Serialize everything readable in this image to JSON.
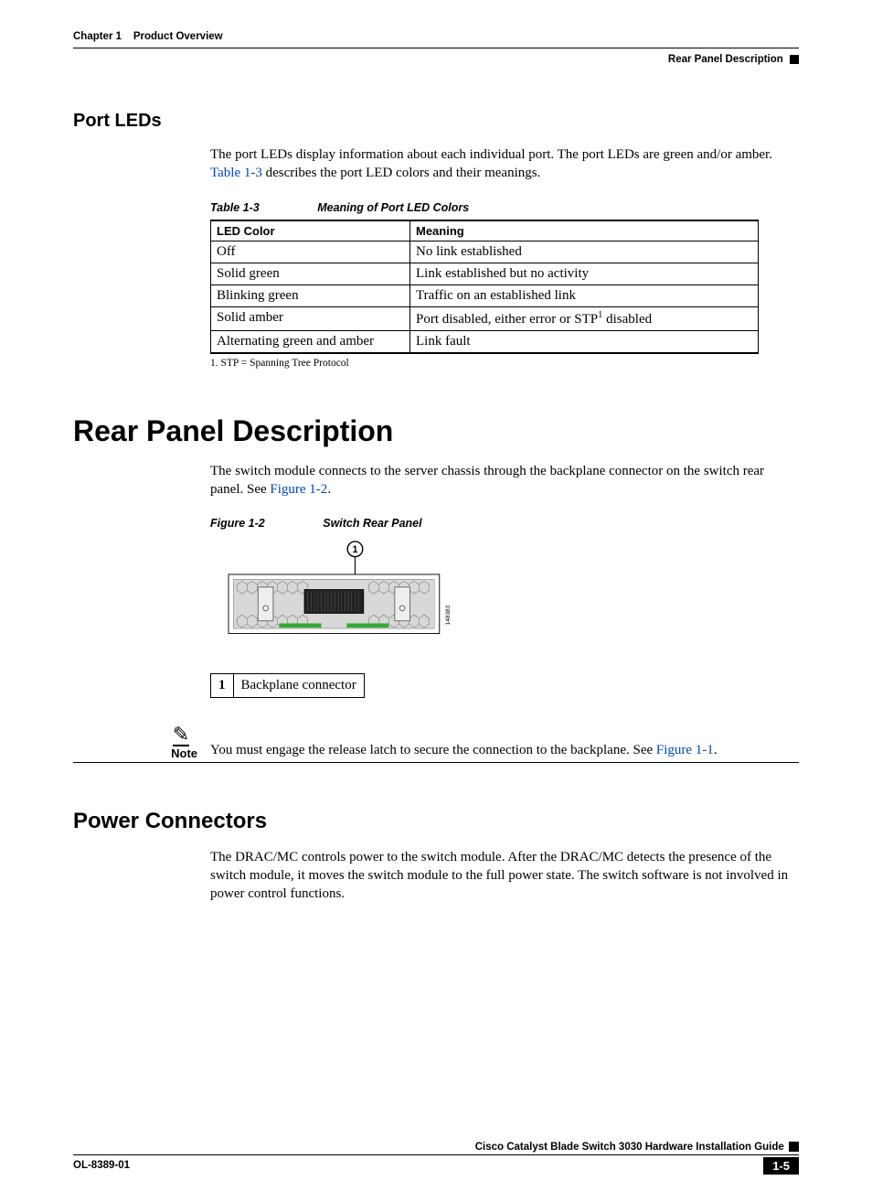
{
  "header": {
    "chapter": "Chapter 1",
    "chapter_title": "Product Overview",
    "right_label": "Rear Panel Description"
  },
  "port_leds": {
    "heading": "Port LEDs",
    "para_prefix": "The port LEDs display information about each individual port. The port LEDs are green and/or amber. ",
    "link": "Table 1-3",
    "para_suffix": " describes the port LED colors and their meanings.",
    "table_num": "Table 1-3",
    "table_title": "Meaning of Port LED Colors",
    "col1": "LED Color",
    "col2": "Meaning",
    "rows": [
      {
        "c1": "Off",
        "c2": "No link established"
      },
      {
        "c1": "Solid green",
        "c2": "Link established but no activity"
      },
      {
        "c1": "Blinking green",
        "c2": "Traffic on an established link"
      },
      {
        "c1": "Solid amber",
        "c2_pre": "Port disabled, either error or STP",
        "c2_sup": "1",
        "c2_post": " disabled"
      },
      {
        "c1": "Alternating green and amber",
        "c2": "Link fault"
      }
    ],
    "footnote": "1.  STP = Spanning Tree Protocol"
  },
  "rear_panel": {
    "heading": "Rear Panel Description",
    "para_prefix": "The switch module connects to the server chassis through the backplane connector on the switch rear panel. See ",
    "link": "Figure 1-2",
    "para_suffix": ".",
    "figure_num": "Figure 1-2",
    "figure_title": "Switch Rear Panel",
    "callout_num": "1",
    "callout_label": "Backplane connector",
    "figure_id": "148383"
  },
  "note": {
    "label": "Note",
    "text_prefix": "You must engage the release latch to secure the connection to the backplane. See ",
    "link": "Figure 1-1",
    "text_suffix": "."
  },
  "power": {
    "heading": "Power Connectors",
    "para": "The DRAC/MC controls power to the switch module. After the DRAC/MC detects the presence of the switch module, it moves the switch module to the full power state. The switch software is not involved in power control functions."
  },
  "footer": {
    "guide_title": "Cisco Catalyst Blade Switch 3030 Hardware Installation Guide",
    "doc_id": "OL-8389-01",
    "page": "1-5"
  }
}
